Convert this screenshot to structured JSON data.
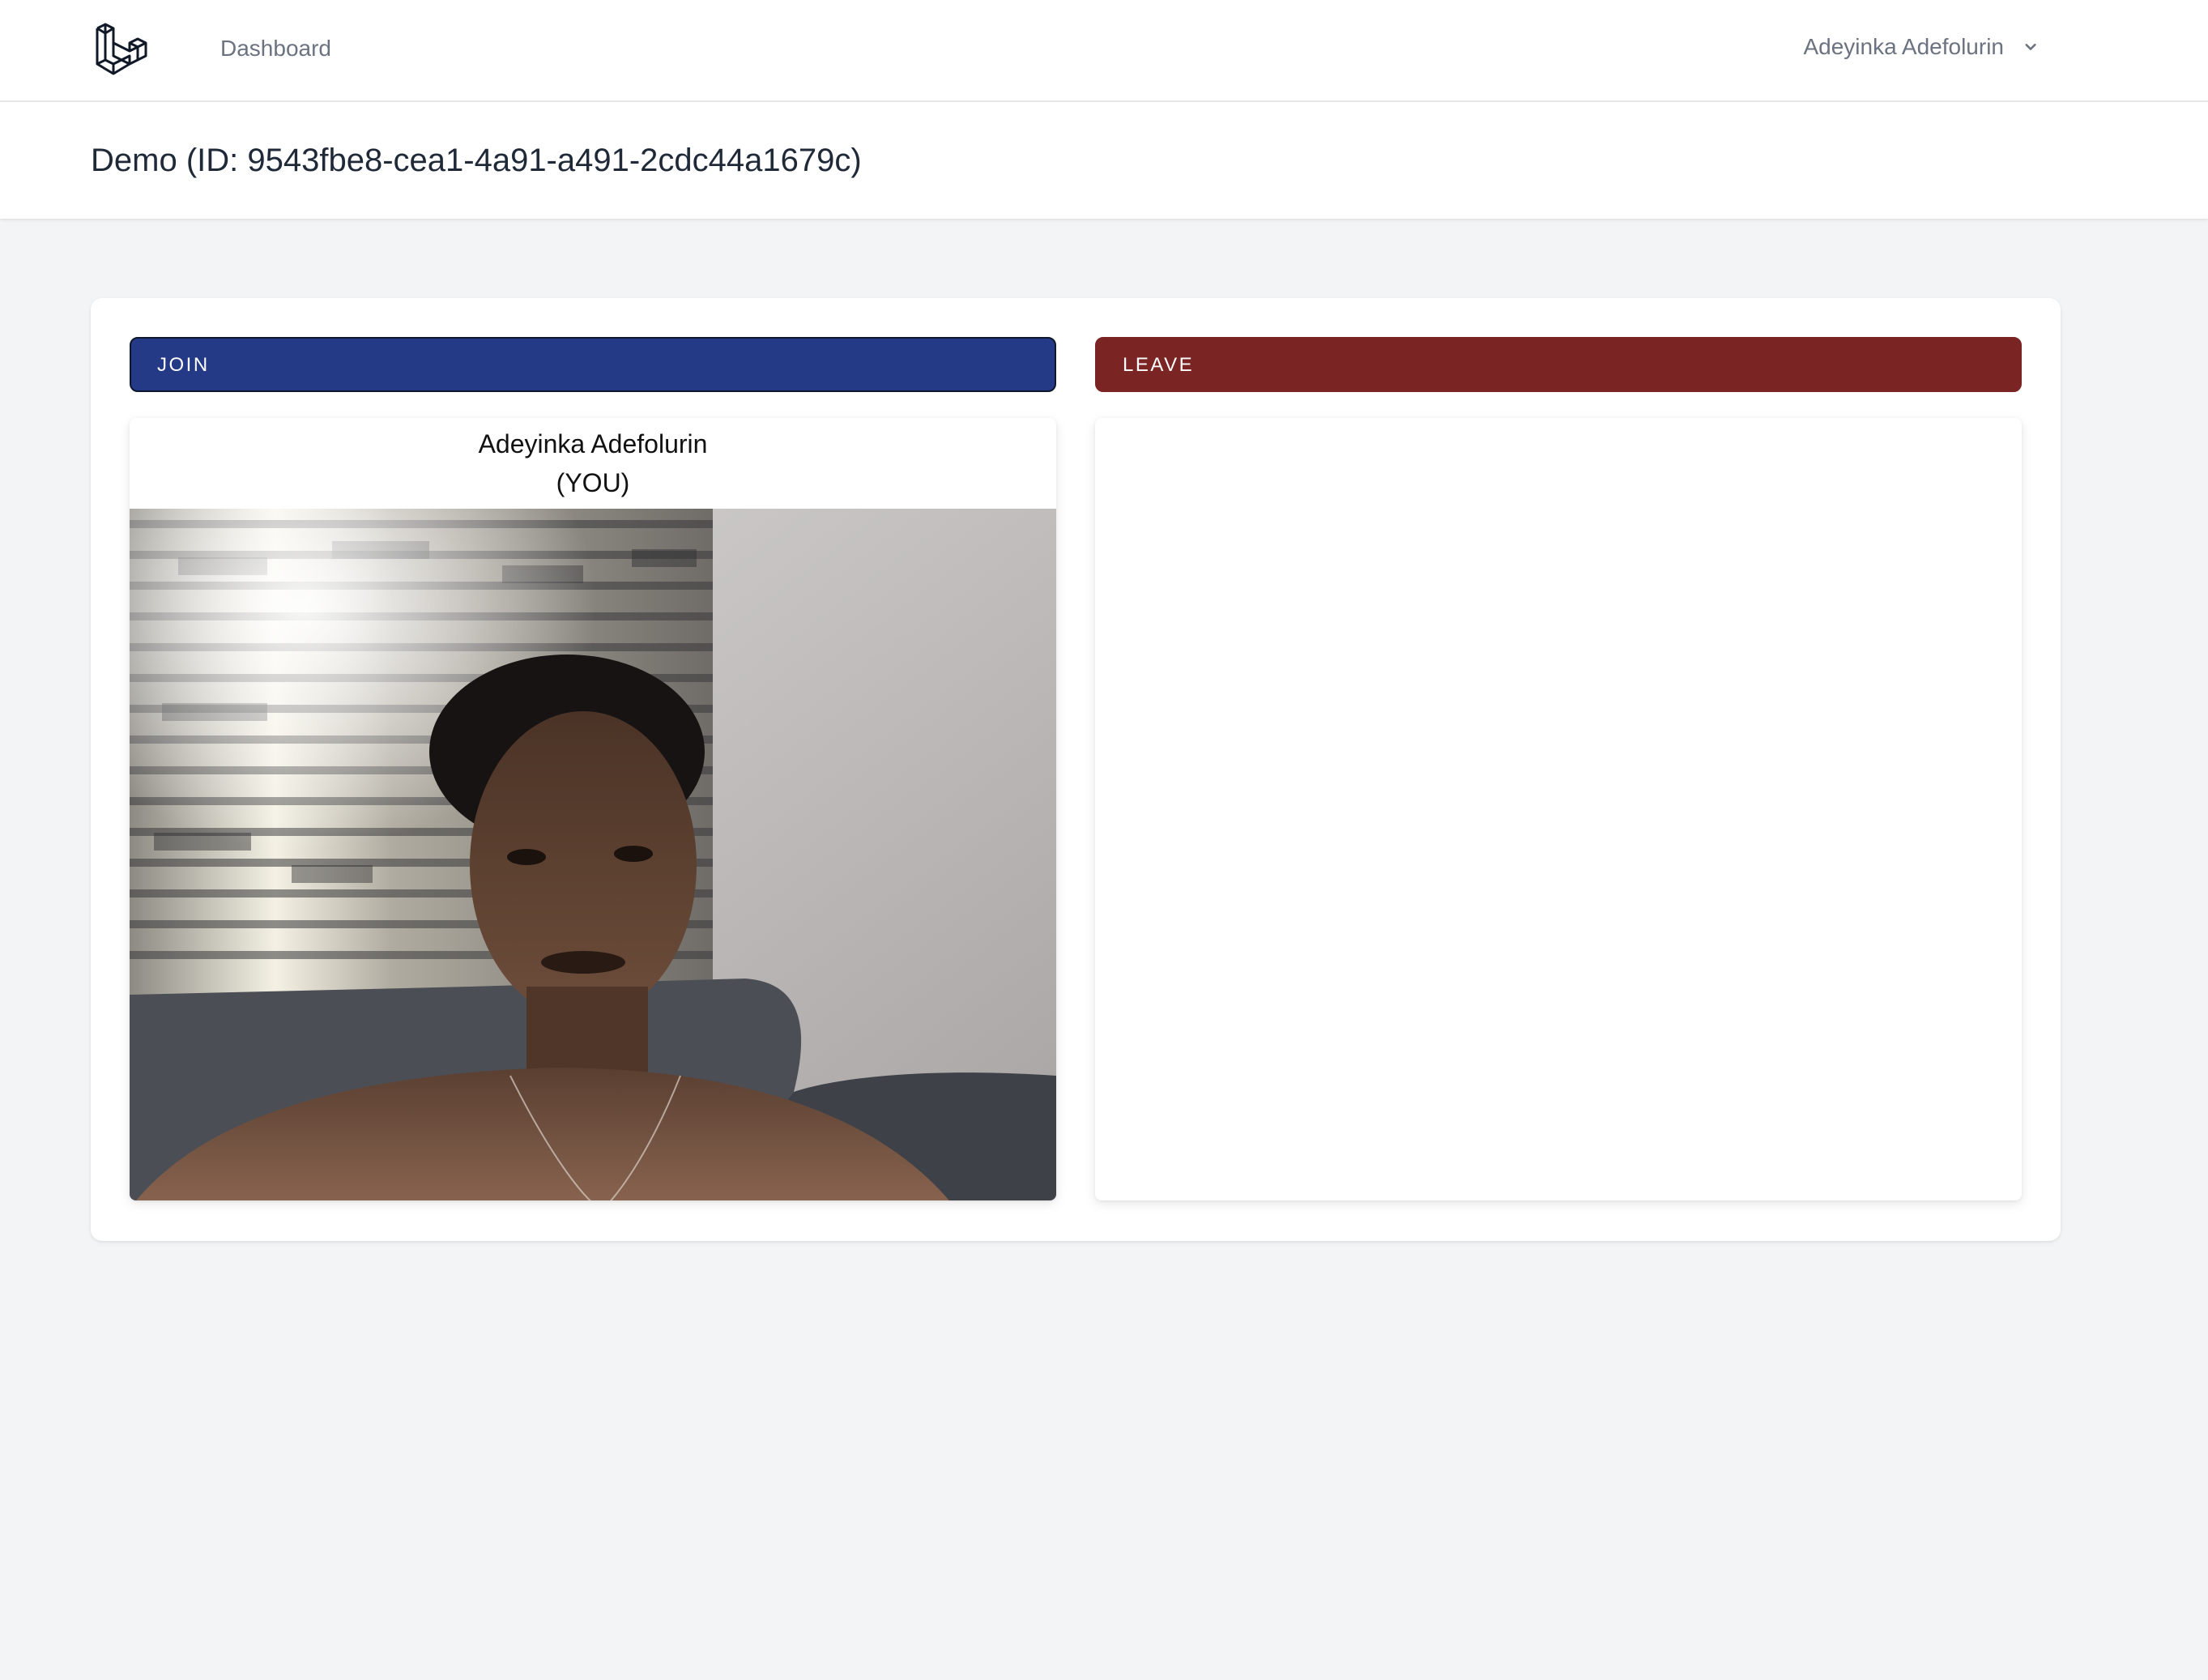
{
  "nav": {
    "logo_icon": "laravel-logo-icon",
    "dashboard_label": "Dashboard",
    "user_name": "Adeyinka Adefolurin",
    "dropdown_icon": "chevron-down-icon"
  },
  "header": {
    "title": "Demo (ID: 9543fbe8-cea1-4a91-a491-2cdc44a1679c)"
  },
  "controls": {
    "join_label": "JOIN",
    "leave_label": "LEAVE",
    "join_color": "#243a87",
    "leave_color": "#7a2424"
  },
  "participants": {
    "local": {
      "name": "Adeyinka Adefolurin",
      "tag": "(YOU)"
    }
  }
}
